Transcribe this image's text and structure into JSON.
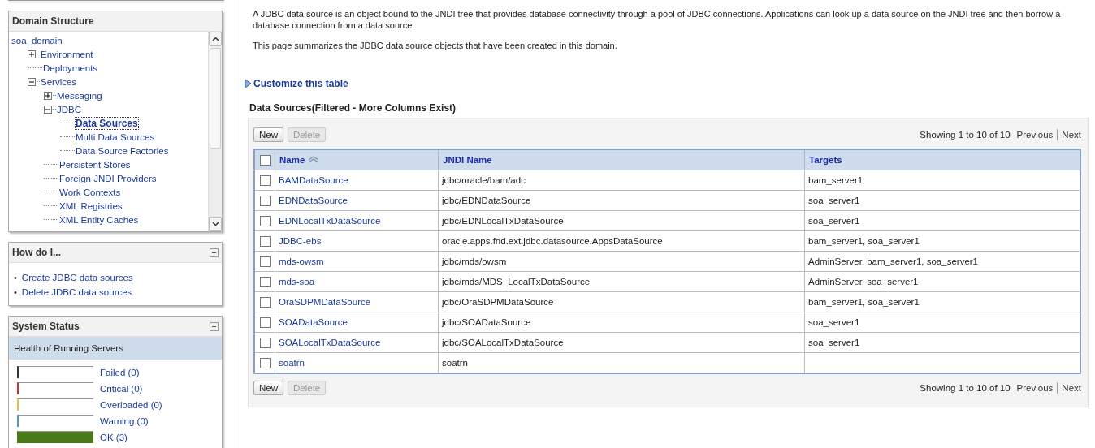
{
  "domain_structure": {
    "title": "Domain Structure",
    "tree": [
      {
        "label": "soa_domain",
        "selected": false,
        "children": [
          {
            "label": "Environment",
            "selected": false,
            "expanded": false
          },
          {
            "label": "Deployments",
            "selected": false
          },
          {
            "label": "Services",
            "selected": false,
            "expanded": true,
            "children": [
              {
                "label": "Messaging",
                "selected": false,
                "expanded": false
              },
              {
                "label": "JDBC",
                "selected": false,
                "expanded": true,
                "children": [
                  {
                    "label": "Data Sources",
                    "selected": true
                  },
                  {
                    "label": "Multi Data Sources",
                    "selected": false
                  },
                  {
                    "label": "Data Source Factories",
                    "selected": false
                  }
                ]
              },
              {
                "label": "Persistent Stores",
                "selected": false
              },
              {
                "label": "Foreign JNDI Providers",
                "selected": false
              },
              {
                "label": "Work Contexts",
                "selected": false
              },
              {
                "label": "XML Registries",
                "selected": false
              },
              {
                "label": "XML Entity Caches",
                "selected": false
              }
            ]
          }
        ]
      }
    ]
  },
  "how_do_i": {
    "title": "How do I...",
    "links": [
      {
        "bullet": "•",
        "label": "Create JDBC data sources"
      },
      {
        "bullet": "•",
        "label": "Delete JDBC data sources"
      }
    ]
  },
  "system_status": {
    "title": "System Status",
    "subtitle": "Health of Running Servers",
    "health": [
      {
        "label": "Failed (0)",
        "level": 0,
        "color": "#333333"
      },
      {
        "label": "Critical (0)",
        "level": 0,
        "color": "#d03030"
      },
      {
        "label": "Overloaded (0)",
        "level": 0,
        "color": "#e8c040"
      },
      {
        "label": "Warning (0)",
        "level": 0,
        "color": "#4aa0b0"
      },
      {
        "label": "OK (3)",
        "level": 1,
        "color": "#4a7a1a"
      }
    ]
  },
  "intro": [
    "A JDBC data source is an object bound to the JNDI tree that provides database connectivity through a pool of JDBC connections. Applications can look up a data source on the JNDI tree and then borrow a database connection from a data source.",
    "This page summarizes the JDBC data source objects that have been created in this domain."
  ],
  "customize_link": "Customize this table",
  "table": {
    "title": "Data Sources(Filtered - More Columns Exist)",
    "top_bar": {
      "buttons": [
        {
          "label": "New",
          "disabled": false
        },
        {
          "label": "Delete",
          "disabled": true
        }
      ],
      "pager": {
        "summary": "Showing 1 to 10 of 10",
        "previous": "Previous",
        "next": "Next"
      }
    },
    "bottom_bar": {
      "buttons": [
        {
          "label": "New",
          "disabled": false
        },
        {
          "label": "Delete",
          "disabled": true
        }
      ],
      "pager": {
        "summary": "Showing 1 to 10 of 10",
        "previous": "Previous",
        "next": "Next"
      }
    },
    "columns": [
      "Name",
      "JNDI Name",
      "Targets"
    ],
    "select_all_checked": false,
    "rows": [
      {
        "checked": false,
        "name": "BAMDataSource",
        "jndi": "jdbc/oracle/bam/adc",
        "targets": "bam_server1"
      },
      {
        "checked": false,
        "name": "EDNDataSource",
        "jndi": "jdbc/EDNDataSource",
        "targets": "soa_server1"
      },
      {
        "checked": false,
        "name": "EDNLocalTxDataSource",
        "jndi": "jdbc/EDNLocalTxDataSource",
        "targets": "soa_server1"
      },
      {
        "checked": false,
        "name": "JDBC-ebs",
        "jndi": "oracle.apps.fnd.ext.jdbc.datasource.AppsDataSource",
        "targets": "bam_server1, soa_server1"
      },
      {
        "checked": false,
        "name": "mds-owsm",
        "jndi": "jdbc/mds/owsm",
        "targets": "AdminServer, bam_server1, soa_server1"
      },
      {
        "checked": false,
        "name": "mds-soa",
        "jndi": "jdbc/mds/MDS_LocalTxDataSource",
        "targets": "AdminServer, soa_server1"
      },
      {
        "checked": false,
        "name": "OraSDPMDataSource",
        "jndi": "jdbc/OraSDPMDataSource",
        "targets": "bam_server1, soa_server1"
      },
      {
        "checked": false,
        "name": "SOADataSource",
        "jndi": "jdbc/SOADataSource",
        "targets": "soa_server1"
      },
      {
        "checked": false,
        "name": "SOALocalTxDataSource",
        "jndi": "jdbc/SOALocalTxDataSource",
        "targets": "soa_server1"
      },
      {
        "checked": false,
        "name": "soatrn",
        "jndi": "soatrn"
      }
    ]
  }
}
